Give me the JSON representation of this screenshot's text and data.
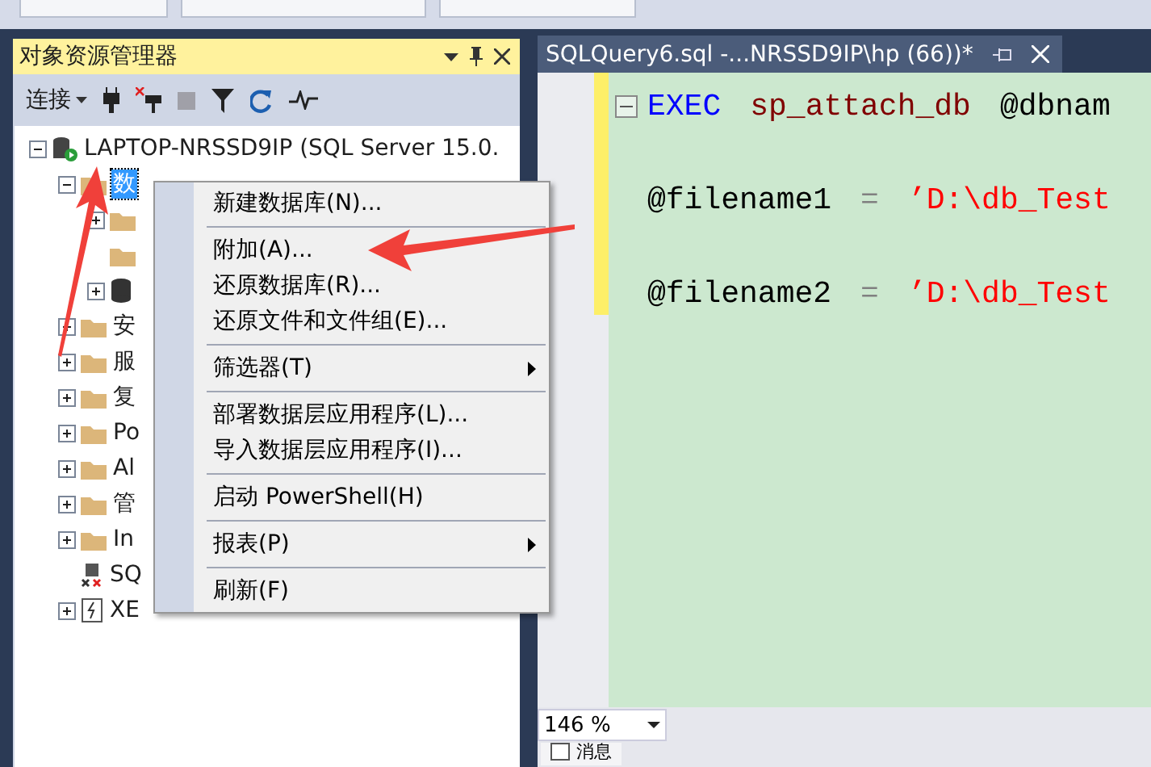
{
  "explorer": {
    "title": "对象资源管理器",
    "toolbar": {
      "connect": "连接"
    },
    "tree": [
      {
        "label": "LAPTOP-NRSSD9IP (SQL Server 15.0.",
        "kind": "server",
        "expanded": true,
        "children": [
          {
            "label": "数",
            "kind": "folder",
            "expanded": true,
            "selected": true,
            "children": [
              {
                "kind": "folder",
                "expanded": false
              },
              {
                "kind": "folder"
              },
              {
                "kind": "database",
                "expanded": false
              }
            ]
          },
          {
            "label": "安",
            "kind": "folder",
            "expanded": false,
            "selected": false
          },
          {
            "label": "服",
            "kind": "folder",
            "expanded": false,
            "selected": false
          },
          {
            "label": "复",
            "kind": "folder",
            "expanded": false,
            "selected": false
          },
          {
            "label": "Po",
            "kind": "folder",
            "expanded": false,
            "selected": false
          },
          {
            "label": "Al",
            "kind": "folder",
            "expanded": false,
            "selected": false
          },
          {
            "label": "管",
            "kind": "folder",
            "expanded": false,
            "selected": false
          },
          {
            "label": "In",
            "kind": "folder",
            "expanded": false,
            "selected": false
          },
          {
            "label": "SQ",
            "kind": "agent",
            "selected": false
          },
          {
            "label": "XE",
            "kind": "xevent",
            "expanded": false,
            "selected": false
          }
        ]
      }
    ]
  },
  "context_menu": [
    {
      "label": "新建数据库(N)...",
      "submenu": false
    },
    {
      "kind": "separator"
    },
    {
      "label": "附加(A)...",
      "submenu": false
    },
    {
      "label": "还原数据库(R)...",
      "submenu": false
    },
    {
      "label": "还原文件和文件组(E)...",
      "submenu": false
    },
    {
      "kind": "separator"
    },
    {
      "label": "筛选器(T)",
      "submenu": true
    },
    {
      "kind": "separator"
    },
    {
      "label": "部署数据层应用程序(L)...",
      "submenu": false
    },
    {
      "label": "导入数据层应用程序(I)...",
      "submenu": false
    },
    {
      "kind": "separator"
    },
    {
      "label": "启动 PowerShell(H)",
      "submenu": false
    },
    {
      "kind": "separator"
    },
    {
      "label": "报表(P)",
      "submenu": true
    },
    {
      "kind": "separator"
    },
    {
      "label": "刷新(F)",
      "submenu": false
    }
  ],
  "editor": {
    "tab": {
      "title": "SQLQuery6.sql -...NRSSD9IP\\hp (66))*"
    },
    "lines": [
      [
        {
          "text": "EXEC",
          "kind": "keyword"
        },
        {
          "text": "sp_attach_db",
          "kind": "proc"
        },
        {
          "text": "@dbnam",
          "kind": "plain"
        }
      ],
      [
        {
          "text": "@filename1",
          "kind": "plain"
        },
        {
          "text": "=",
          "kind": "operator"
        },
        {
          "text": "’D:\\db_Test",
          "kind": "string"
        }
      ],
      [
        {
          "text": "@filename2",
          "kind": "plain"
        },
        {
          "text": "=",
          "kind": "operator"
        },
        {
          "text": "’D:\\db_Test",
          "kind": "string"
        }
      ]
    ],
    "zoom": "146 %",
    "bottom_tab": "消息"
  }
}
